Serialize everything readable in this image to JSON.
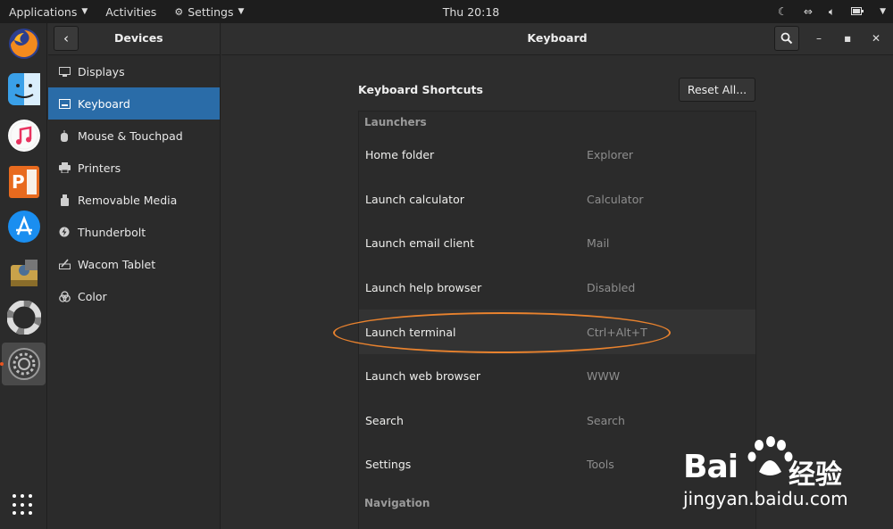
{
  "topbar": {
    "applications": "Applications",
    "activities": "Activities",
    "settings_menu": "Settings",
    "clock": "Thu 20:18"
  },
  "dock": {
    "apps": [
      {
        "name": "Firefox",
        "icon": "firefox-icon"
      },
      {
        "name": "Finder",
        "icon": "finder-icon"
      },
      {
        "name": "Music",
        "icon": "music-icon"
      },
      {
        "name": "Presentation",
        "icon": "presentation-icon"
      },
      {
        "name": "App Store",
        "icon": "app-store-icon"
      },
      {
        "name": "Disk Utility",
        "icon": "disk-icon"
      },
      {
        "name": "Help",
        "icon": "lifebuoy-icon"
      },
      {
        "name": "Settings",
        "icon": "settings-icon",
        "active": true
      }
    ]
  },
  "sidebar": {
    "title": "Devices",
    "items": [
      {
        "label": "Displays",
        "icon": "display-icon"
      },
      {
        "label": "Keyboard",
        "icon": "keyboard-icon",
        "active": true
      },
      {
        "label": "Mouse & Touchpad",
        "icon": "mouse-icon"
      },
      {
        "label": "Printers",
        "icon": "printer-icon"
      },
      {
        "label": "Removable Media",
        "icon": "usb-icon"
      },
      {
        "label": "Thunderbolt",
        "icon": "thunderbolt-icon"
      },
      {
        "label": "Wacom Tablet",
        "icon": "tablet-icon"
      },
      {
        "label": "Color",
        "icon": "color-icon"
      }
    ]
  },
  "main": {
    "title": "Keyboard",
    "section_title": "Keyboard Shortcuts",
    "reset_label": "Reset All...",
    "groups": [
      {
        "name": "Launchers",
        "rows": [
          {
            "name": "Home folder",
            "accel": "Explorer"
          },
          {
            "name": "Launch calculator",
            "accel": "Calculator"
          },
          {
            "name": "Launch email client",
            "accel": "Mail"
          },
          {
            "name": "Launch help browser",
            "accel": "Disabled"
          },
          {
            "name": "Launch terminal",
            "accel": "Ctrl+Alt+T"
          },
          {
            "name": "Launch web browser",
            "accel": "WWW"
          },
          {
            "name": "Search",
            "accel": "Search"
          },
          {
            "name": "Settings",
            "accel": "Tools"
          }
        ]
      },
      {
        "name": "Navigation",
        "rows": []
      }
    ]
  },
  "watermark": {
    "brand_left": "Bai",
    "brand_right": "经验",
    "url": "jingyan.baidu.com"
  },
  "colors": {
    "accent": "#2a6ca8",
    "annotation": "#e8822e"
  }
}
